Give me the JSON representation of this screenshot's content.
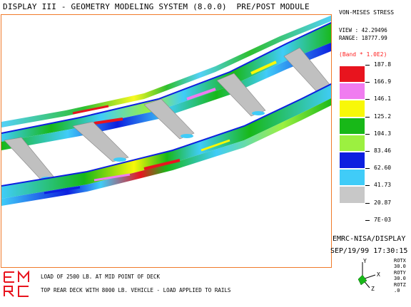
{
  "window": {
    "title": "DISPLAY III - GEOMETRY MODELING SYSTEM (8.0.0)  PRE/POST MODULE"
  },
  "legend": {
    "title": "VON-MISES STRESS",
    "view_label": "VIEW : 42.29496",
    "range_label": "RANGE: 18777.99",
    "band_label": "(Band * 1.0E2)",
    "levels": [
      "187.8",
      "166.9",
      "146.1",
      "125.2",
      "104.3",
      "83.46",
      "62.60",
      "41.73",
      "20.87",
      "7E-03"
    ],
    "band_colors": [
      "#e8141e",
      "#f07cf0",
      "#f8f808",
      "#18b818",
      "#9cf040",
      "#0d1fe0",
      "#40ccf8",
      "#c8c8c8"
    ]
  },
  "footer": {
    "brand": "EMRC-NISA/DISPLAY",
    "datetime": "SEP/19/99 17:30:15",
    "caption_line1": "LOAD OF 2500 LB. AT MID POINT OF DECK",
    "caption_line2": "TOP REAR DECK WITH 8000 LB. VEHICLE - LOAD APPLIED TO RAILS",
    "logo_text": "EMRC"
  },
  "triad": {
    "axis_x": "X",
    "axis_y": "Y",
    "axis_z": "Z",
    "rotx_label": "ROTX",
    "rotx_value": "30.0",
    "roty_label": "ROTY",
    "roty_value": "30.0",
    "rotz_label": "ROTZ",
    "rotz_value": ".0"
  },
  "colors": {
    "frame": "#f07a2a",
    "max_stress": "#e8141e",
    "min_stress": "#c8c8c8"
  }
}
